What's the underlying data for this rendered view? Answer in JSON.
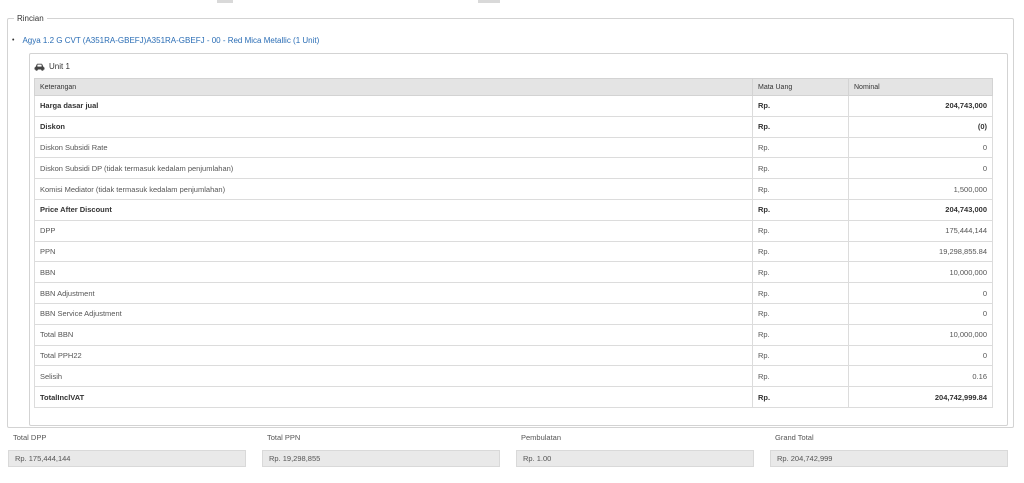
{
  "section": {
    "legend": "Rincian"
  },
  "item": {
    "title": "Agya 1.2 G CVT (A351RA-GBEFJ)A351RA-GBEFJ - 00 - Red Mica Metallic (1 Unit)"
  },
  "unit": {
    "title": "Unit 1",
    "icon": "car-icon",
    "columns": [
      "Keterangan",
      "Mata Uang",
      "Nominal"
    ],
    "rows": [
      {
        "label": "Harga dasar jual",
        "currency": "Rp.",
        "value": "204,743,000",
        "bold": true
      },
      {
        "label": "Diskon",
        "currency": "Rp.",
        "value": "(0)",
        "bold": true
      },
      {
        "label": "Diskon Subsidi Rate",
        "currency": "Rp.",
        "value": "0",
        "bold": false
      },
      {
        "label": "Diskon Subsidi DP (tidak termasuk kedalam penjumlahan)",
        "currency": "Rp.",
        "value": "0",
        "bold": false
      },
      {
        "label": "Komisi Mediator (tidak termasuk kedalam penjumlahan)",
        "currency": "Rp.",
        "value": "1,500,000",
        "bold": false
      },
      {
        "label": "Price After Discount",
        "currency": "Rp.",
        "value": "204,743,000",
        "bold": true
      },
      {
        "label": "DPP",
        "currency": "Rp.",
        "value": "175,444,144",
        "bold": false
      },
      {
        "label": "PPN",
        "currency": "Rp.",
        "value": "19,298,855.84",
        "bold": false
      },
      {
        "label": "BBN",
        "currency": "Rp.",
        "value": "10,000,000",
        "bold": false
      },
      {
        "label": "BBN Adjustment",
        "currency": "Rp.",
        "value": "0",
        "bold": false
      },
      {
        "label": "BBN Service Adjustment",
        "currency": "Rp.",
        "value": "0",
        "bold": false
      },
      {
        "label": "Total BBN",
        "currency": "Rp.",
        "value": "10,000,000",
        "bold": false
      },
      {
        "label": "Total PPH22",
        "currency": "Rp.",
        "value": "0",
        "bold": false
      },
      {
        "label": "Selisih",
        "currency": "Rp.",
        "value": "0.16",
        "bold": false
      },
      {
        "label": "TotalInclVAT",
        "currency": "Rp.",
        "value": "204,742,999.84",
        "bold": true
      }
    ]
  },
  "totals": {
    "dpp": {
      "label": "Total DPP",
      "value": "Rp. 175,444,144"
    },
    "ppn": {
      "label": "Total PPN",
      "value": "Rp. 19,298,855"
    },
    "rounding": {
      "label": "Pembulatan",
      "value": "Rp. 1.00"
    },
    "grand": {
      "label": "Grand Total",
      "value": "Rp. 204,742,999"
    }
  },
  "colors": {
    "link": "#2a6db5",
    "header_bg": "#e4e4e4",
    "readonly_bg": "#e9e9e9"
  }
}
